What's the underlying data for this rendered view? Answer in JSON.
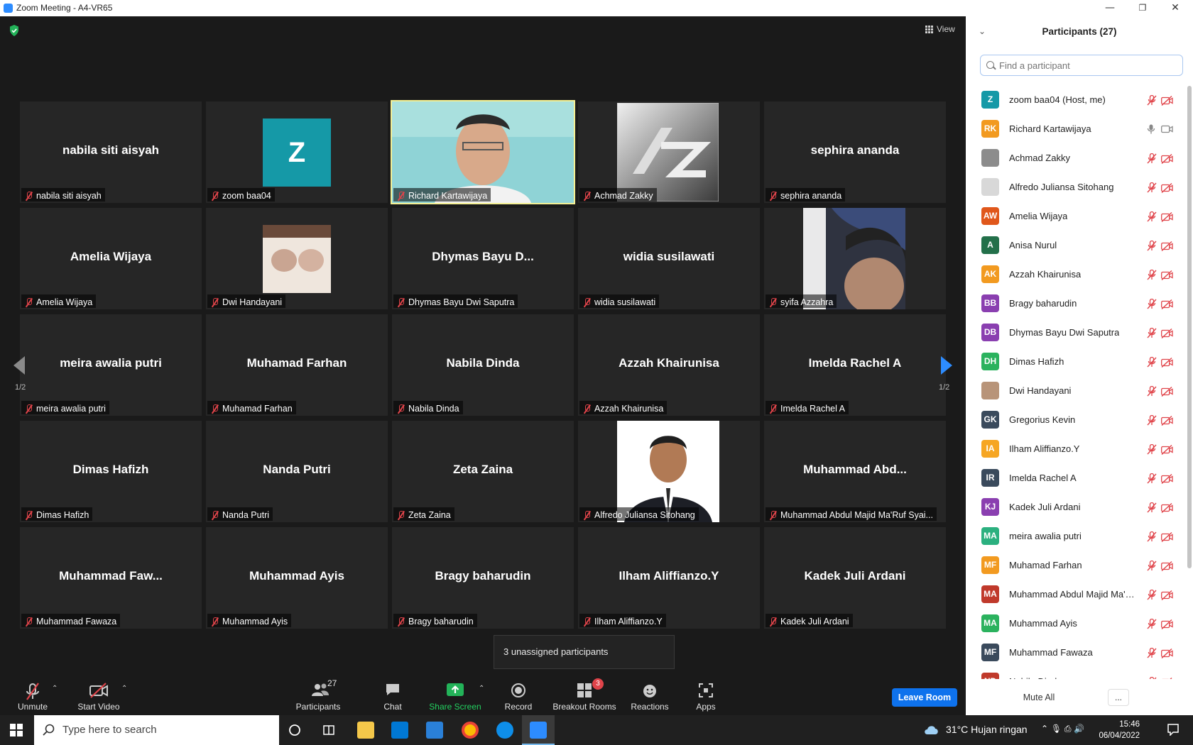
{
  "window": {
    "title": "Zoom Meeting - A4-VR65",
    "minimize": "—",
    "restore": "❐",
    "close": "✕"
  },
  "view_button": "View",
  "tiles": [
    {
      "big": "nabila siti aisyah",
      "label": "nabila siti aisyah"
    },
    {
      "big": "",
      "label": "zoom baa04",
      "avatar": "Z"
    },
    {
      "big": "",
      "label": "Richard Kartawijaya"
    },
    {
      "big": "",
      "label": "Achmad Zakky"
    },
    {
      "big": "sephira ananda",
      "label": "sephira ananda"
    },
    {
      "big": "Amelia Wijaya",
      "label": "Amelia Wijaya"
    },
    {
      "big": "",
      "label": "Dwi Handayani"
    },
    {
      "big": "Dhymas  Bayu  D...",
      "label": "Dhymas Bayu Dwi Saputra"
    },
    {
      "big": "widia susilawati",
      "label": "widia susilawati"
    },
    {
      "big": "",
      "label": "syifa Azzahra"
    },
    {
      "big": "meira awalia putri",
      "label": "meira awalia putri"
    },
    {
      "big": "Muhamad Farhan",
      "label": "Muhamad Farhan"
    },
    {
      "big": "Nabila Dinda",
      "label": "Nabila Dinda"
    },
    {
      "big": "Azzah Khairunisa",
      "label": "Azzah Khairunisa"
    },
    {
      "big": "Imelda Rachel A",
      "label": "Imelda Rachel A"
    },
    {
      "big": "Dimas Hafizh",
      "label": "Dimas Hafizh"
    },
    {
      "big": "Nanda Putri",
      "label": "Nanda Putri"
    },
    {
      "big": "Zeta Zaina",
      "label": "Zeta Zaina"
    },
    {
      "big": "",
      "label": "Alfredo Juliansa Sitohang"
    },
    {
      "big": "Muhammad  Abd...",
      "label": "Muhammad Abdul Majid Ma'Ruf Syai..."
    },
    {
      "big": "Muhammad  Faw...",
      "label": "Muhammad Fawaza"
    },
    {
      "big": "Muhammad Ayis",
      "label": "Muhammad Ayis"
    },
    {
      "big": "Bragy baharudin",
      "label": "Bragy baharudin"
    },
    {
      "big": "Ilham Aliffianzo.Y",
      "label": "Ilham Aliffianzo.Y"
    },
    {
      "big": "Kadek Juli Ardani",
      "label": "Kadek Juli Ardani"
    }
  ],
  "pager": {
    "left": "1/2",
    "right": "1/2"
  },
  "tooltip": "3 unassigned participants",
  "toolbar": {
    "unmute": "Unmute",
    "start_video": "Start Video",
    "participants": "Participants",
    "participants_count": "27",
    "chat": "Chat",
    "share_screen": "Share Screen",
    "record": "Record",
    "breakout_rooms": "Breakout Rooms",
    "breakout_badge": "3",
    "reactions": "Reactions",
    "apps": "Apps",
    "leave": "Leave Room",
    "caret": "⌃"
  },
  "panel": {
    "title": "Participants (27)",
    "collapse": "⌄",
    "search_placeholder": "Find a participant",
    "mute_all": "Mute All",
    "more": "...",
    "participants": [
      {
        "initials": "Z",
        "name": "zoom baa04 (Host, me)",
        "color": "#1599a7",
        "mic_on": false
      },
      {
        "initials": "RK",
        "name": "Richard Kartawijaya",
        "color": "#f29a20",
        "mic_on": true
      },
      {
        "initials": "",
        "name": "Achmad Zakky",
        "color": "#8c8c8c",
        "mic_on": false
      },
      {
        "initials": "",
        "name": "Alfredo Juliansa Sitohang",
        "color": "#d8d8d8",
        "mic_on": false
      },
      {
        "initials": "AW",
        "name": "Amelia Wijaya",
        "color": "#e0571b",
        "mic_on": false
      },
      {
        "initials": "A",
        "name": "Anisa Nurul",
        "color": "#23704a",
        "mic_on": false
      },
      {
        "initials": "AK",
        "name": "Azzah Khairunisa",
        "color": "#f29a20",
        "mic_on": false
      },
      {
        "initials": "BB",
        "name": "Bragy baharudin",
        "color": "#8a3fb0",
        "mic_on": false
      },
      {
        "initials": "DB",
        "name": "Dhymas Bayu Dwi Saputra",
        "color": "#8a3fb0",
        "mic_on": false
      },
      {
        "initials": "DH",
        "name": "Dimas Hafizh",
        "color": "#2bb25e",
        "mic_on": false
      },
      {
        "initials": "",
        "name": "Dwi Handayani",
        "color": "#b89479",
        "mic_on": false
      },
      {
        "initials": "GK",
        "name": "Gregorius Kevin",
        "color": "#3a4a5c",
        "mic_on": false
      },
      {
        "initials": "IA",
        "name": "Ilham Aliffianzo.Y",
        "color": "#f6a623",
        "mic_on": false
      },
      {
        "initials": "IR",
        "name": "Imelda Rachel A",
        "color": "#3a4a5c",
        "mic_on": false
      },
      {
        "initials": "KJ",
        "name": "Kadek Juli Ardani",
        "color": "#8a3fb0",
        "mic_on": false
      },
      {
        "initials": "MA",
        "name": "meira awalia putri",
        "color": "#2bb07f",
        "mic_on": false
      },
      {
        "initials": "MF",
        "name": "Muhamad Farhan",
        "color": "#f29a20",
        "mic_on": false
      },
      {
        "initials": "MA",
        "name": "Muhammad Abdul Majid Ma'R...",
        "color": "#c0392b",
        "mic_on": false
      },
      {
        "initials": "MA",
        "name": "Muhammad Ayis",
        "color": "#2bb25e",
        "mic_on": false
      },
      {
        "initials": "MF",
        "name": "Muhammad Fawaza",
        "color": "#3a4a5c",
        "mic_on": false
      },
      {
        "initials": "ND",
        "name": "Nabila Dinda",
        "color": "#c0392b",
        "mic_on": false
      }
    ]
  },
  "taskbar": {
    "search_placeholder": "Type here to search",
    "weather": "31°C  Hujan ringan",
    "time": "15:46",
    "date": "06/04/2022"
  }
}
